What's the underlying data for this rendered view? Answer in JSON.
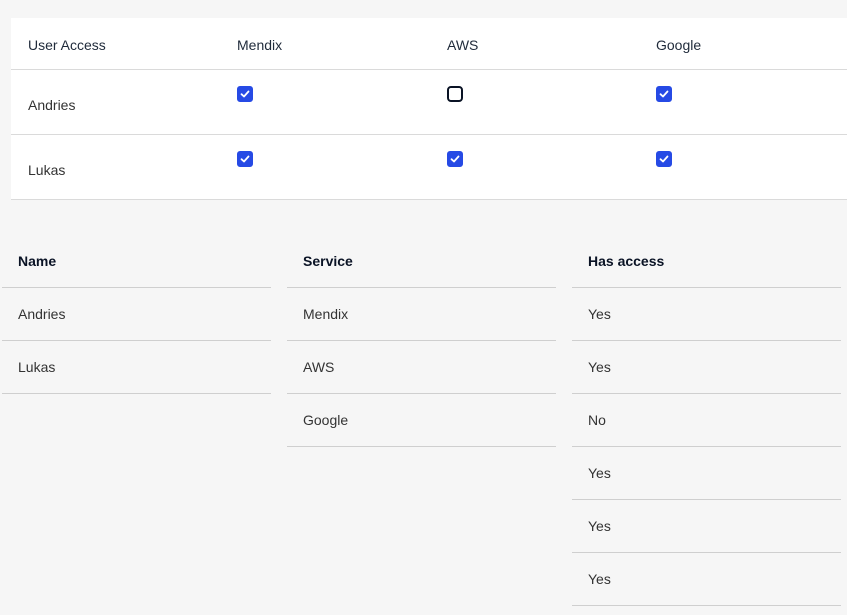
{
  "matrix": {
    "headers": [
      "User Access",
      "Mendix",
      "AWS",
      "Google"
    ],
    "rows": [
      {
        "name": "Andries",
        "access": [
          true,
          false,
          true
        ]
      },
      {
        "name": "Lukas",
        "access": [
          true,
          true,
          true
        ]
      }
    ]
  },
  "list": {
    "name_header": "Name",
    "service_header": "Service",
    "access_header": "Has access",
    "names": [
      "Andries",
      "Lukas"
    ],
    "services": [
      "Mendix",
      "AWS",
      "Google"
    ],
    "access": [
      "Yes",
      "Yes",
      "No",
      "Yes",
      "Yes",
      "Yes"
    ]
  },
  "colors": {
    "checkbox_checked": "#264ae5",
    "checkbox_unchecked_border": "#0a1325",
    "background": "#f6f6f6"
  },
  "icons": {
    "checked": "check-icon"
  }
}
